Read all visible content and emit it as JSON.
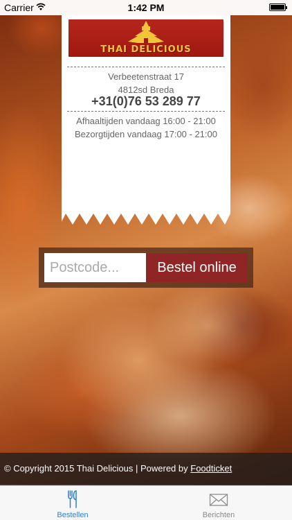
{
  "status_bar": {
    "carrier": "Carrier",
    "time": "1:42 PM"
  },
  "restaurant": {
    "logo_text": "THAI DELICIOUS",
    "street": "Verbeetenstraat 17",
    "city": "4812sd Breda",
    "phone": "+31(0)76 53 289 77",
    "pickup_times": "Afhaaltijden vandaag 16:00 - 21:00",
    "delivery_times": "Bezorgtijden vandaag 17:00 - 21:00"
  },
  "order_form": {
    "postcode_placeholder": "Postcode...",
    "postcode_value": "",
    "order_button_label": "Bestel online"
  },
  "footer": {
    "copyright_text": "© Copyright 2015 Thai Delicious | Powered by ",
    "powered_by_link": "Foodticket"
  },
  "tab_bar": {
    "tabs": [
      {
        "label": "Bestellen",
        "icon": "fork-knife-icon",
        "selected": true
      },
      {
        "label": "Berichten",
        "icon": "envelope-icon",
        "selected": false
      }
    ]
  },
  "colors": {
    "accent_blue": "#2b7fdc",
    "order_button": "#8f2525",
    "logo_red": "#b5261d",
    "logo_gold": "#f3c33a"
  }
}
